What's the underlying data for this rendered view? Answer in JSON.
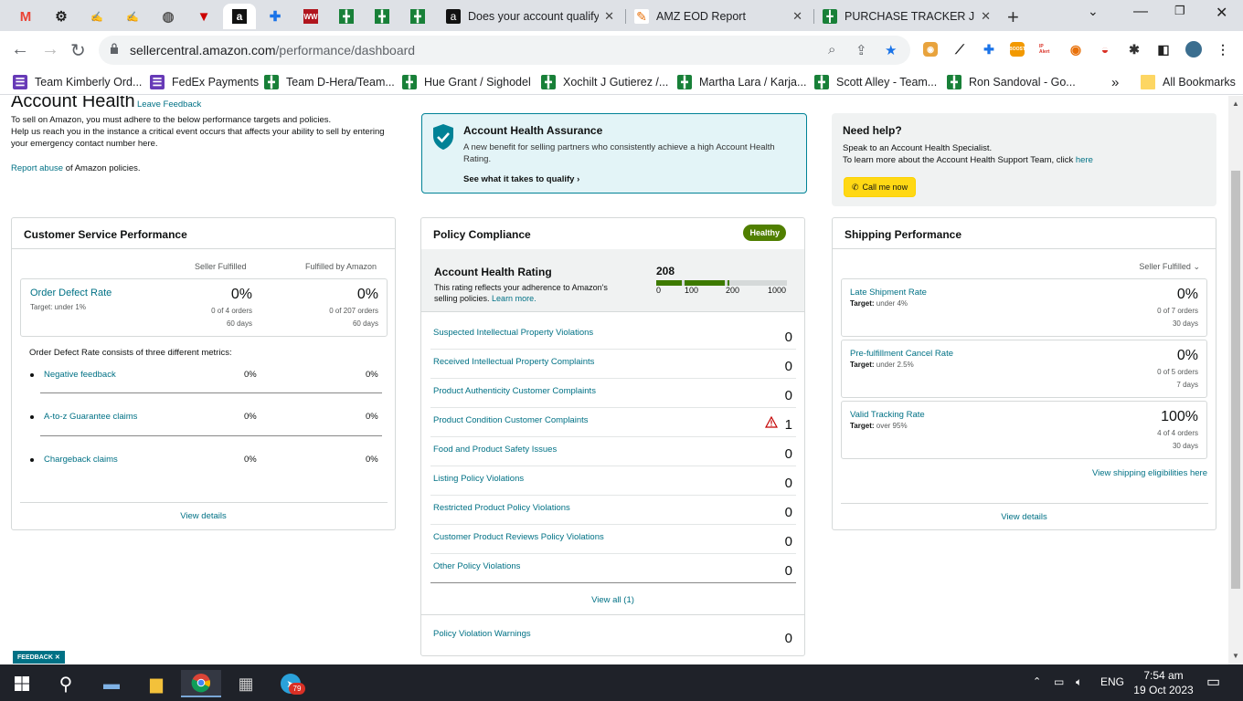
{
  "browser": {
    "tabs": [
      {
        "label": "Does your account qualify",
        "icon": "amazon-icon"
      },
      {
        "label": "AMZ EOD Report",
        "icon": "edit-icon"
      },
      {
        "label": "PURCHASE TRACKER JUN",
        "icon": "sheets-icon"
      }
    ],
    "pinned_tabs": [
      "gmail-icon",
      "openai-icon",
      "script-icon",
      "script-icon",
      "globe-icon",
      "pinterest-icon",
      "amazon-icon",
      "cross-icon",
      "ww-icon",
      "sheets-icon",
      "sheets-icon",
      "sheets-icon"
    ],
    "url_domain": "sellercentral.amazon.com",
    "url_path": "/performance/dashboard",
    "bookmarks": [
      {
        "label": "Team Kimberly Ord...",
        "icon": "form-icon"
      },
      {
        "label": "FedEx Payments",
        "icon": "form-icon"
      },
      {
        "label": "Team D-Hera/Team...",
        "icon": "sheets-icon"
      },
      {
        "label": "Hue Grant / Sighodel",
        "icon": "sheets-icon"
      },
      {
        "label": "Xochilt J Gutierez /...",
        "icon": "sheets-icon"
      },
      {
        "label": "Martha Lara / Karja...",
        "icon": "sheets-icon"
      },
      {
        "label": "Scott Alley - Team...",
        "icon": "sheets-icon"
      },
      {
        "label": "Ron Sandoval - Go...",
        "icon": "sheets-icon"
      }
    ],
    "all_bookmarks": "All Bookmarks",
    "more_bookmarks": "»",
    "new_tab": "+",
    "extension_labels": {
      "boost": "BOOST",
      "ip_alert": "IP Alert"
    }
  },
  "header": {
    "title": "Account Health",
    "leave_feedback": "Leave Feedback",
    "intro_line1": "To sell on Amazon, you must adhere to the below performance targets and policies.",
    "intro_line2": "Help us reach you in the instance a critical event occurs that affects your ability to sell by entering your emergency contact number",
    "intro_link": "here",
    "report_abuse_link": "Report abuse",
    "report_abuse_text": "of Amazon policies."
  },
  "assurance": {
    "title": "Account Health Assurance",
    "description": "A new benefit for selling partners who consistently achieve a high Account Health Rating.",
    "link": "See what it takes to qualify"
  },
  "help": {
    "title": "Need help?",
    "line1": "Speak to an Account Health Specialist.",
    "line2": "To learn more about the Account Health Support Team, click",
    "line2_link": "here",
    "button": "Call me now"
  },
  "customer_service": {
    "title": "Customer Service Performance",
    "col_seller": "Seller Fulfilled",
    "col_amazon": "Fulfilled by Amazon",
    "odr": {
      "name": "Order Defect Rate",
      "target": "Target: under 1%",
      "seller_value": "0%",
      "seller_orders": "0 of 4 orders",
      "seller_period": "60 days",
      "amazon_value": "0%",
      "amazon_orders": "0 of 207 orders",
      "amazon_period": "60 days"
    },
    "consists_text": "Order Defect Rate consists of three different metrics:",
    "metrics": [
      {
        "name": "Negative feedback",
        "seller": "0%",
        "amazon": "0%"
      },
      {
        "name": "A-to-z Guarantee claims",
        "seller": "0%",
        "amazon": "0%"
      },
      {
        "name": "Chargeback claims",
        "seller": "0%",
        "amazon": "0%"
      }
    ],
    "view_details": "View details"
  },
  "policy": {
    "title": "Policy Compliance",
    "status": "Healthy",
    "ahr_title": "Account Health Rating",
    "ahr_desc": "This rating reflects your adherence to Amazon's selling policies.",
    "ahr_learn": "Learn more.",
    "ahr_score": "208",
    "ahr_score_value": 208,
    "ahr_max": 1000,
    "ahr_ticks": [
      "0",
      "100",
      "200",
      "1000"
    ],
    "rows": [
      {
        "name": "Suspected Intellectual Property Violations",
        "value": "0",
        "warning": false
      },
      {
        "name": "Received Intellectual Property Complaints",
        "value": "0",
        "warning": false
      },
      {
        "name": "Product Authenticity Customer Complaints",
        "value": "0",
        "warning": false
      },
      {
        "name": "Product Condition Customer Complaints",
        "value": "1",
        "warning": true
      },
      {
        "name": "Food and Product Safety Issues",
        "value": "0",
        "warning": false
      },
      {
        "name": "Listing Policy Violations",
        "value": "0",
        "warning": false
      },
      {
        "name": "Restricted Product Policy Violations",
        "value": "0",
        "warning": false
      },
      {
        "name": "Customer Product Reviews Policy Violations",
        "value": "0",
        "warning": false
      },
      {
        "name": "Other Policy Violations",
        "value": "0",
        "warning": false
      }
    ],
    "view_all": "View all (1)",
    "warnings_name": "Policy Violation Warnings",
    "warnings_value": "0"
  },
  "shipping": {
    "title": "Shipping Performance",
    "filter": "Seller Fulfilled",
    "metrics": [
      {
        "name": "Late Shipment Rate",
        "target_label": "Target:",
        "target": "under 4%",
        "value": "0%",
        "orders": "0 of 7 orders",
        "period": "30 days"
      },
      {
        "name": "Pre-fulfillment Cancel Rate",
        "target_label": "Target:",
        "target": "under 2.5%",
        "value": "0%",
        "orders": "0 of 5 orders",
        "period": "7 days"
      },
      {
        "name": "Valid Tracking Rate",
        "target_label": "Target:",
        "target": "over 95%",
        "value": "100%",
        "orders": "4 of 4 orders",
        "period": "30 days"
      }
    ],
    "eligibilities_link": "View shipping eligibilities here",
    "view_details": "View details"
  },
  "feedback_tab": "FEEDBACK",
  "taskbar": {
    "telegram_badge": "79",
    "language": "ENG",
    "time": "7:54 am",
    "date": "19 Oct 2023"
  },
  "colors": {
    "healthy": "#507f00",
    "link": "#007185",
    "call_button": "#ffd814",
    "warning": "#c40000"
  }
}
